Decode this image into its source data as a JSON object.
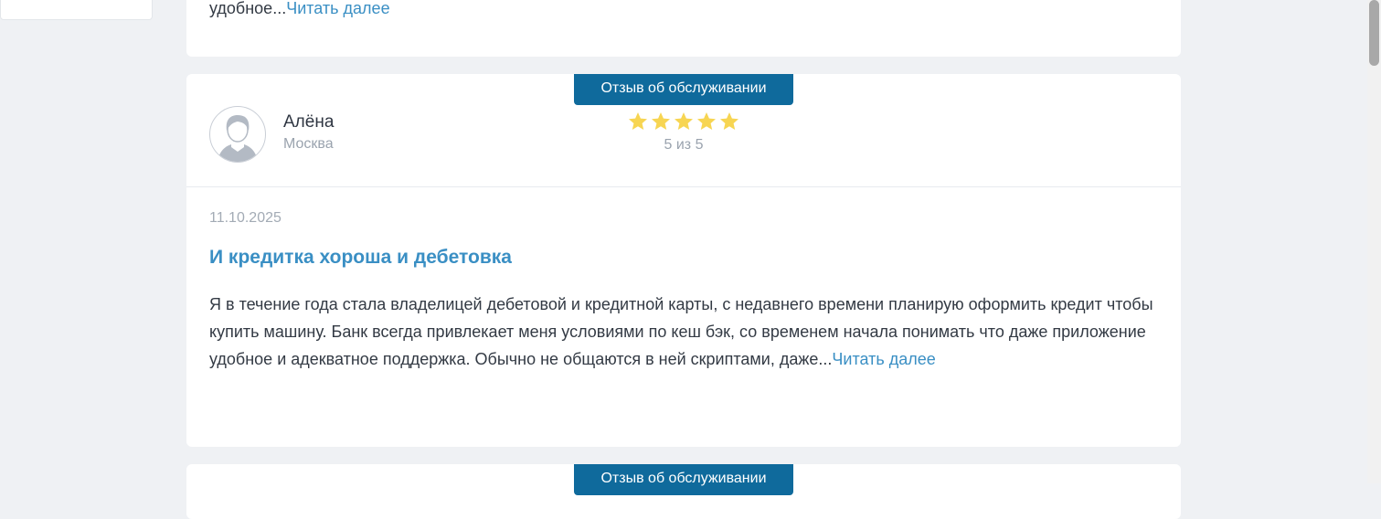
{
  "previous_review": {
    "text_tail": "удобное...",
    "read_more": "Читать далее"
  },
  "review": {
    "badge": "Отзыв об обслуживании",
    "author_name": "Алёна",
    "author_city": "Москва",
    "rating": 5,
    "rating_text": "5 из 5",
    "date": "11.10.2025",
    "title": "И кредитка хороша и дебетовка",
    "text": "Я в течение года стала владелицей дебетовой и кредитной карты, с недавнего времени планирую оформить кредит чтобы купить машину. Банк всегда привлекает меня условиями по кеш бэк, со временем начала понимать что даже приложение удобное и адекватное поддержка. Обычно не общаются в ней скриптами, даже...",
    "read_more": "Читать далее"
  },
  "next_review": {
    "badge": "Отзыв об обслуживании"
  },
  "colors": {
    "badge_bg": "#0f6a9c",
    "link": "#3a8fc4",
    "star": "#f7d552",
    "page_bg": "#eff1f4"
  },
  "icons": {
    "avatar": "user-avatar-icon",
    "star": "star-icon"
  }
}
